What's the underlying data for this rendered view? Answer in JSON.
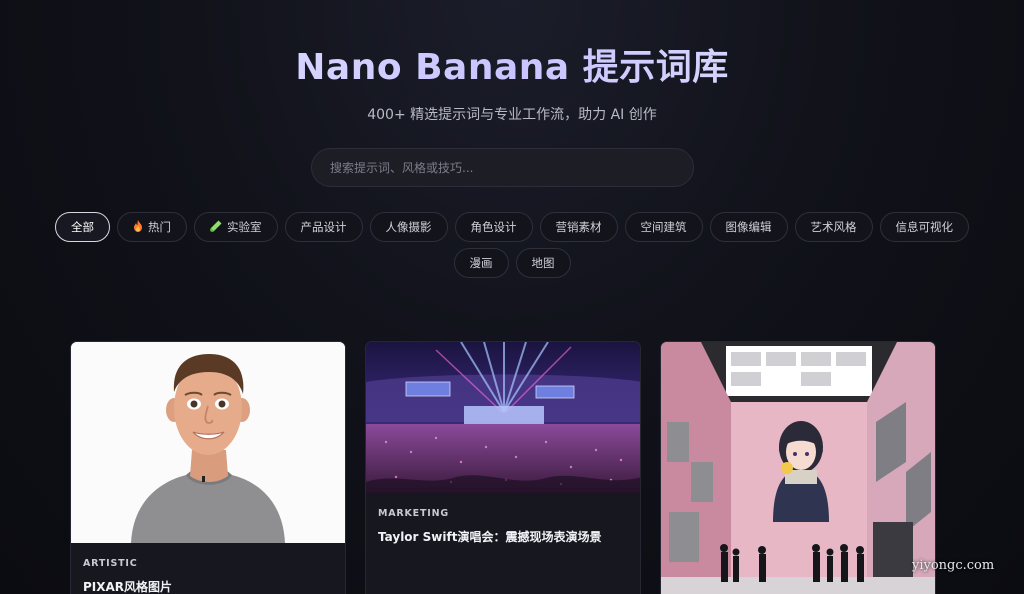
{
  "header": {
    "title": "Nano Banana 提示词库",
    "subtitle": "400+ 精选提示词与专业工作流，助力 AI 创作"
  },
  "search": {
    "placeholder": "搜索提示词、风格或技巧...",
    "value": ""
  },
  "filters": {
    "active": "全部",
    "items": [
      {
        "label": "全部",
        "icon": null
      },
      {
        "label": "热门",
        "icon": "fire-icon"
      },
      {
        "label": "实验室",
        "icon": "flask-icon"
      },
      {
        "label": "产品设计",
        "icon": null
      },
      {
        "label": "人像摄影",
        "icon": null
      },
      {
        "label": "角色设计",
        "icon": null
      },
      {
        "label": "营销素材",
        "icon": null
      },
      {
        "label": "空间建筑",
        "icon": null
      },
      {
        "label": "图像编辑",
        "icon": null
      },
      {
        "label": "艺术风格",
        "icon": null
      },
      {
        "label": "信息可视化",
        "icon": null
      },
      {
        "label": "漫画",
        "icon": null
      },
      {
        "label": "地图",
        "icon": null
      }
    ]
  },
  "cards": [
    {
      "category": "ARTISTIC",
      "title": "PIXAR风格图片",
      "image": "pixar-style-portrait"
    },
    {
      "category": "MARKETING",
      "title": "Taylor Swift演唱会：震撼现场表演场景",
      "image": "concert-stadium-photo"
    },
    {
      "category": "",
      "title": "",
      "image": "anime-gallery-interior"
    }
  ],
  "watermark": "yiyongc.com",
  "colors": {
    "background": "#0b0c11",
    "title": "#d9d6ff",
    "chip_border": "#2e2f3a",
    "card_background": "#17181f"
  }
}
